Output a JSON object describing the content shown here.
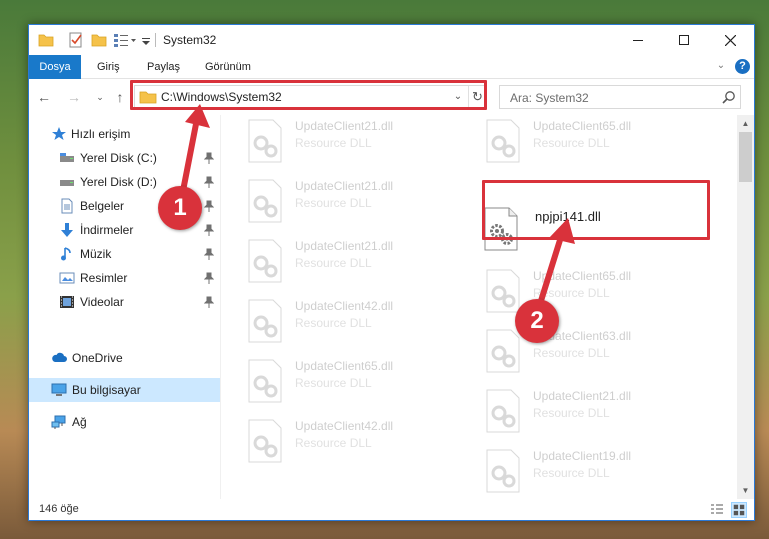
{
  "window": {
    "title": "System32",
    "controls": {
      "minimize": "—",
      "maximize": "☐",
      "close": "✕"
    }
  },
  "ribbon": {
    "tabs": [
      "Dosya",
      "Giriş",
      "Paylaş",
      "Görünüm"
    ],
    "collapse_glyph": "⌄",
    "help_glyph": "?"
  },
  "nav": {
    "back": "←",
    "forward": "→",
    "recent": "⌄",
    "up": "↑",
    "address": "C:\\Windows\\System32",
    "address_dropdown": "⌄",
    "refresh": "↻",
    "search_placeholder": "Ara: System32"
  },
  "sidebar": {
    "items": [
      {
        "label": "Hızlı erişim",
        "icon": "star-icon"
      },
      {
        "label": "Yerel Disk (C:)",
        "icon": "drive-icon",
        "pinned": true
      },
      {
        "label": "Yerel Disk (D:)",
        "icon": "drive-icon",
        "pinned": true
      },
      {
        "label": "Belgeler",
        "icon": "documents-icon",
        "pinned": true
      },
      {
        "label": "İndirmeler",
        "icon": "download-icon",
        "pinned": true
      },
      {
        "label": "Müzik",
        "icon": "music-icon",
        "pinned": true
      },
      {
        "label": "Resimler",
        "icon": "pictures-icon",
        "pinned": true
      },
      {
        "label": "Videolar",
        "icon": "videos-icon",
        "pinned": true
      },
      {
        "label": "OneDrive",
        "icon": "cloud-icon"
      },
      {
        "label": "Bu bilgisayar",
        "icon": "computer-icon",
        "selected": true
      },
      {
        "label": "Ağ",
        "icon": "network-icon"
      }
    ],
    "pin_glyph": "📌"
  },
  "files": {
    "left_column": [
      {
        "name": "UpdateClient21.dll",
        "type": "Resource DLL"
      },
      {
        "name": "UpdateClient21.dll",
        "type": "Resource DLL"
      },
      {
        "name": "UpdateClient21.dll",
        "type": "Resource DLL"
      },
      {
        "name": "UpdateClient42.dll",
        "type": "Resource DLL"
      },
      {
        "name": "UpdateClient65.dll",
        "type": "Resource DLL"
      },
      {
        "name": "UpdateClient42.dll",
        "type": "Resource DLL"
      }
    ],
    "right_column": [
      {
        "name": "UpdateClient65.dll",
        "type": "Resource DLL"
      },
      {
        "name": "npjpi141.dll",
        "type": "",
        "highlighted": true
      },
      {
        "name": "UpdateClient65.dll",
        "type": "Resource DLL"
      },
      {
        "name": "UpdateClient63.dll",
        "type": "Resource DLL"
      },
      {
        "name": "UpdateClient21.dll",
        "type": "Resource DLL"
      },
      {
        "name": "UpdateClient19.dll",
        "type": "Resource DLL"
      }
    ]
  },
  "scrollbar": {
    "up": "▲",
    "down": "▼"
  },
  "status": {
    "item_count": "146 öğe"
  },
  "annotations": {
    "step1": "1",
    "step2": "2",
    "color": "#d9323b"
  },
  "colors": {
    "accent": "#1979ca",
    "selection": "#cce8ff"
  }
}
